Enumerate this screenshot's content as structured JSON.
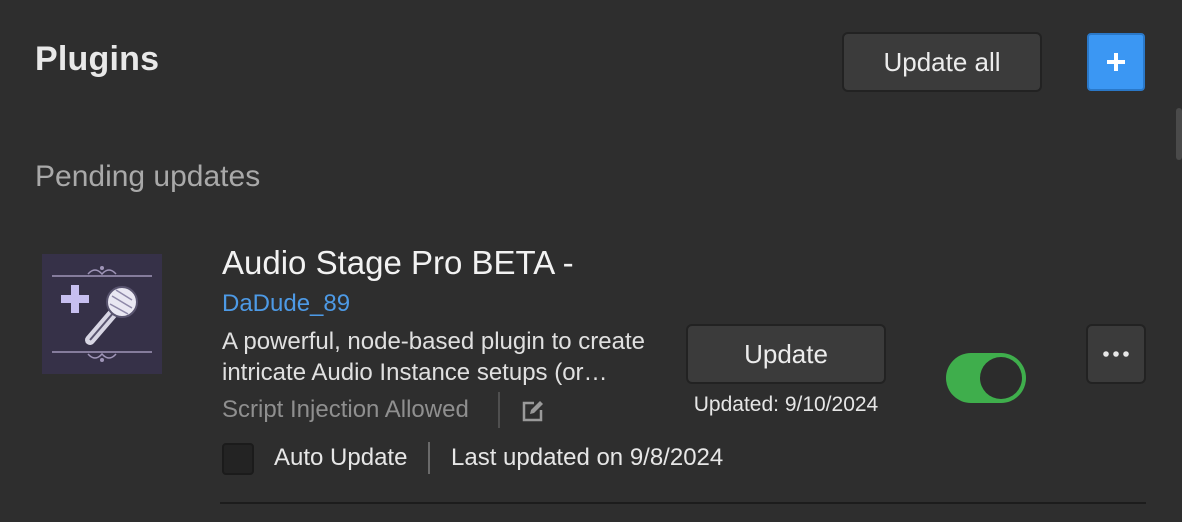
{
  "header": {
    "title": "Plugins",
    "update_all_label": "Update all",
    "add_button_icon": "plus-icon",
    "accent_color": "#3b97f3"
  },
  "section": {
    "title": "Pending updates"
  },
  "plugin": {
    "name": "Audio Stage Pro BETA -",
    "author": "DaDude_89",
    "description": "A powerful, node-based plugin to create intricate Audio Instance setups (or…",
    "permission": "Script Injection Allowed",
    "permission_edit_icon": "edit-icon",
    "auto_update_label": "Auto Update",
    "auto_update_checked": false,
    "last_updated": "Last updated on 9/8/2024",
    "update_label": "Update",
    "updated_date": "Updated: 9/10/2024",
    "enabled": true,
    "toggle_color": "#3fae4c",
    "more_icon": "more-horizontal-icon"
  }
}
